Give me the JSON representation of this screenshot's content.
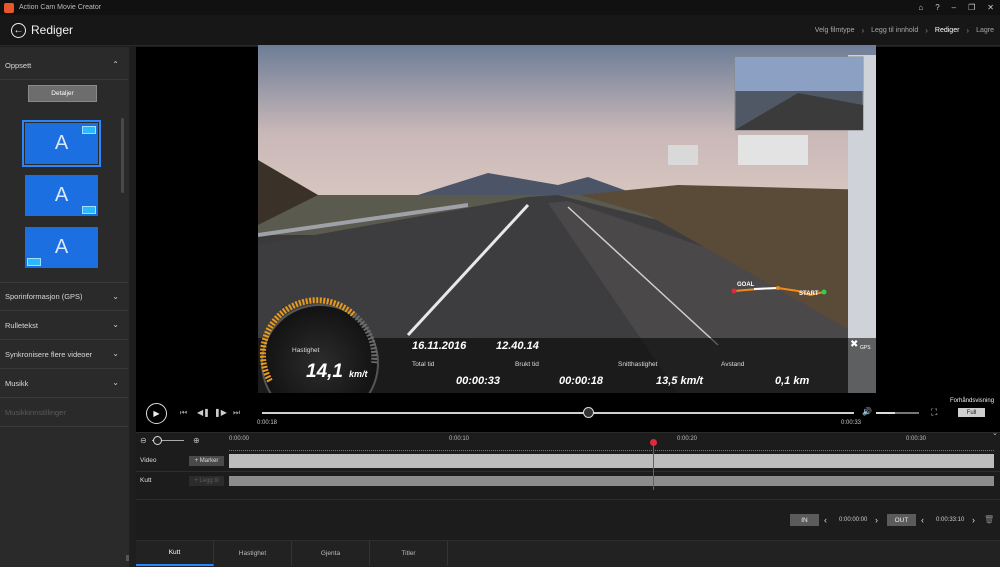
{
  "window": {
    "title": "Action Cam Movie Creator",
    "controls": [
      "⌂",
      "?",
      "–",
      "❐",
      "✕"
    ]
  },
  "header": {
    "back_icon": "arrow-left-icon",
    "title": "Rediger",
    "breadcrumb": [
      {
        "label": "Velg filmtype",
        "active": false
      },
      {
        "label": "Legg til innhold",
        "active": false
      },
      {
        "label": "Rediger",
        "active": true
      },
      {
        "label": "Lagre",
        "active": false
      }
    ]
  },
  "sidebar": {
    "sections": [
      {
        "label": "Oppsett",
        "expanded": true
      },
      {
        "label": "Sporinformasjon (GPS)",
        "expanded": false
      },
      {
        "label": "Rulletekst",
        "expanded": false
      },
      {
        "label": "Synkronisere flere videoer",
        "expanded": false
      },
      {
        "label": "Musikk",
        "expanded": false
      },
      {
        "label": "Musikkinnstillinger",
        "expanded": false,
        "disabled": true
      }
    ],
    "details_button": "Detaljer",
    "templates": [
      {
        "letter": "A",
        "selected": true
      },
      {
        "letter": "A",
        "selected": false
      },
      {
        "letter": "A",
        "selected": false
      }
    ]
  },
  "overlay": {
    "speed_label": "Hastighet",
    "speed_value": "14,1",
    "speed_unit": "km/t",
    "date": "16.11.2016",
    "time": "12.40.14",
    "stats": [
      {
        "label": "Total tid",
        "value": "00:00:33"
      },
      {
        "label": "Brukt tid",
        "value": "00:00:18"
      },
      {
        "label": "Snitthastighet",
        "value": "13,5 km/t"
      },
      {
        "label": "Avstand",
        "value": "0,1 km"
      }
    ],
    "route_goal": "GOAL",
    "route_start": "START",
    "gps_label": "GPS"
  },
  "player": {
    "current_time": "0:00:18",
    "total_time": "0:00:33",
    "progress": 0.55,
    "volume": 0.45,
    "preview_label": "Forhåndsvisning",
    "full_button": "Full"
  },
  "timeline": {
    "ticks": [
      "0:00:00",
      "0:00:10",
      "0:00:20",
      "0:00:30"
    ],
    "video_label": "Video",
    "cut_label": "Kutt",
    "marker_button": "+ Marker",
    "add_button": "+ Legg til",
    "in_button": "IN",
    "in_time": "0:00:00:00",
    "out_button": "OUT",
    "out_time": "0:00:33:10"
  },
  "tabs": [
    {
      "label": "Kutt",
      "active": true
    },
    {
      "label": "Hastighet",
      "active": false
    },
    {
      "label": "Gjenta",
      "active": false
    },
    {
      "label": "Titler",
      "active": false
    }
  ],
  "colors": {
    "accent": "#2a86ff",
    "template_blue": "#1b6fe0",
    "playhead": "#e3283e",
    "route": "#f08a1c"
  }
}
